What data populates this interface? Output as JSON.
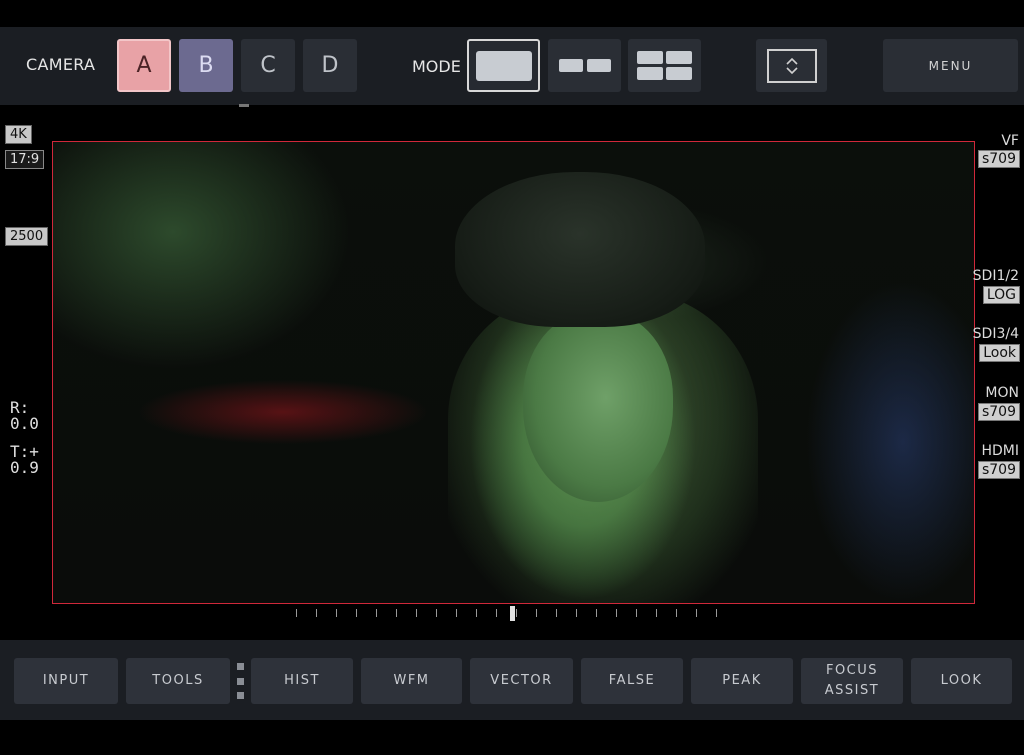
{
  "header": {
    "camera_label": "CAMERA",
    "cameras": [
      {
        "label": "A",
        "state": "active-red"
      },
      {
        "label": "B",
        "state": "active-purple"
      },
      {
        "label": "C",
        "state": "idle"
      },
      {
        "label": "D",
        "state": "idle"
      }
    ],
    "mode_label": "MODE",
    "modes": [
      {
        "icon": "single-view-icon",
        "selected": true
      },
      {
        "icon": "dual-view-icon",
        "selected": false
      },
      {
        "icon": "quad-view-icon",
        "selected": false
      }
    ],
    "fit_icon": "expand-collapse-icon",
    "menu_label": "MENU"
  },
  "left_panel": {
    "resolution": "4K",
    "aspect": "17:9",
    "iso": "2500",
    "r_label": "R:",
    "r_value": "0.0",
    "t_label": "T:+",
    "t_value": "0.9"
  },
  "outputs": [
    {
      "label": "VF",
      "value": "s709"
    },
    {
      "label": "SDI1/2",
      "value": "LOG"
    },
    {
      "label": "SDI3/4",
      "value": "Look"
    },
    {
      "label": "MON",
      "value": "s709"
    },
    {
      "label": "HDMI",
      "value": "s709"
    }
  ],
  "footer": {
    "buttons": [
      {
        "label": "INPUT"
      },
      {
        "label": "TOOLS"
      },
      {
        "label": "HIST"
      },
      {
        "label": "WFM"
      },
      {
        "label": "VECTOR"
      },
      {
        "label": "FALSE"
      },
      {
        "label": "PEAK"
      },
      {
        "label": "FOCUS ASSIST"
      },
      {
        "label": "LOOK"
      }
    ]
  },
  "colors": {
    "camera_a": "#e8a2a6",
    "camera_b": "#6c6a90",
    "frame_border": "#d0283a",
    "bar_bg": "#1b1e23"
  }
}
